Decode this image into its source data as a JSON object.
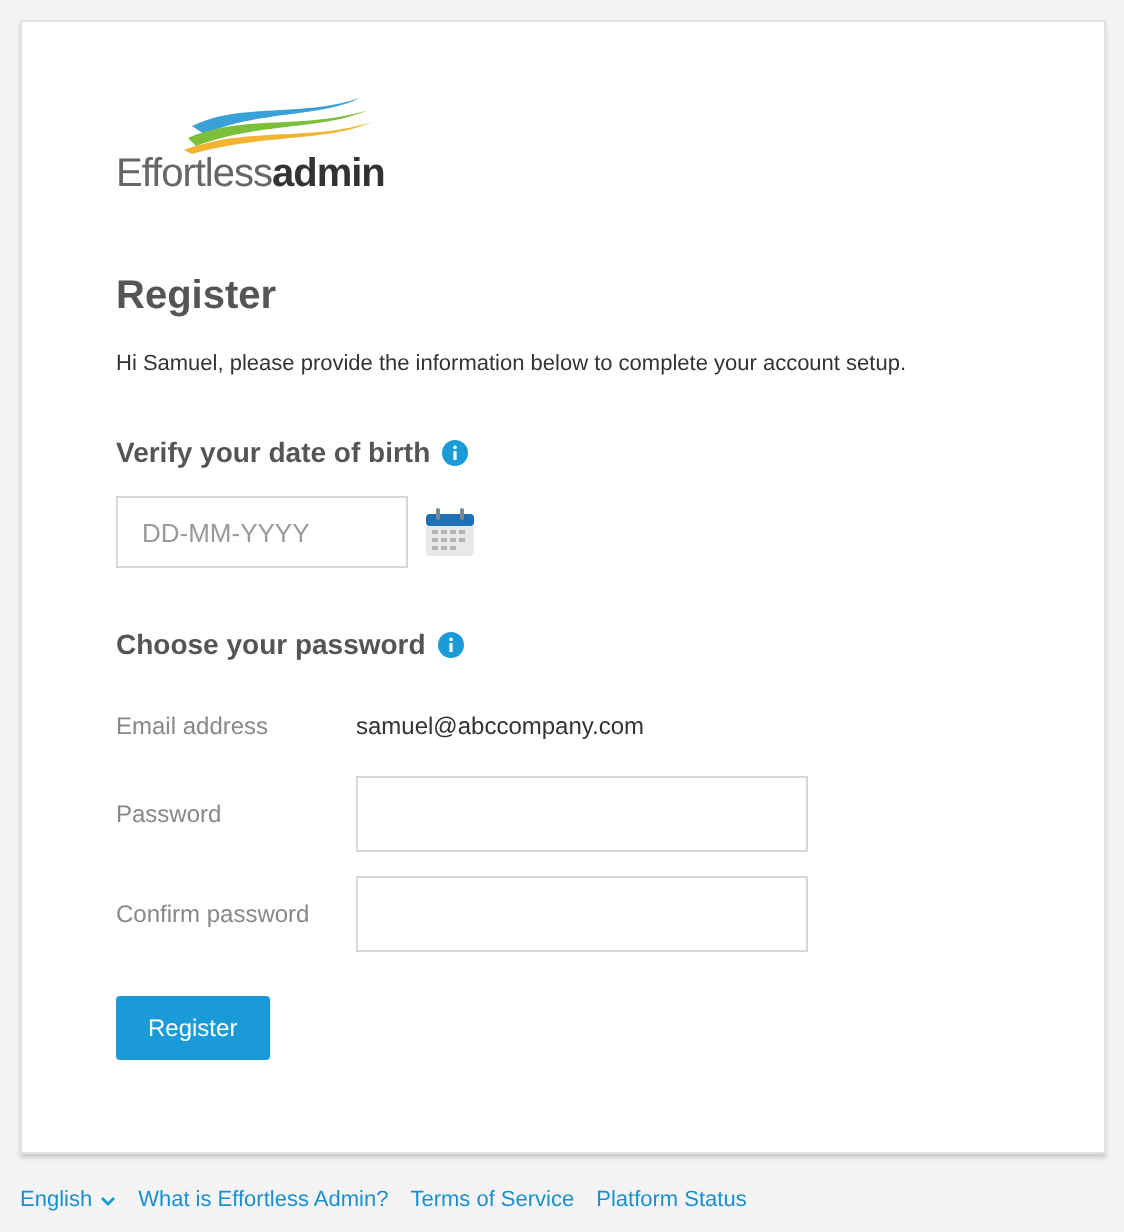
{
  "logo": {
    "light": "Effortless",
    "bold": "admin"
  },
  "title": "Register",
  "intro": "Hi Samuel, please provide the information below to complete your account setup.",
  "dob_section": {
    "heading": "Verify your date of birth",
    "placeholder": "DD-MM-YYYY"
  },
  "password_section": {
    "heading": "Choose your password",
    "rows": [
      {
        "kind": "text",
        "label": "Email address",
        "value": "samuel@abccompany.com"
      },
      {
        "kind": "input",
        "label": "Password"
      },
      {
        "kind": "input",
        "label": "Confirm password"
      }
    ]
  },
  "submit": "Register",
  "footer": {
    "language": "English",
    "links": [
      "What is Effortless Admin?",
      "Terms of Service",
      "Platform Status"
    ]
  }
}
